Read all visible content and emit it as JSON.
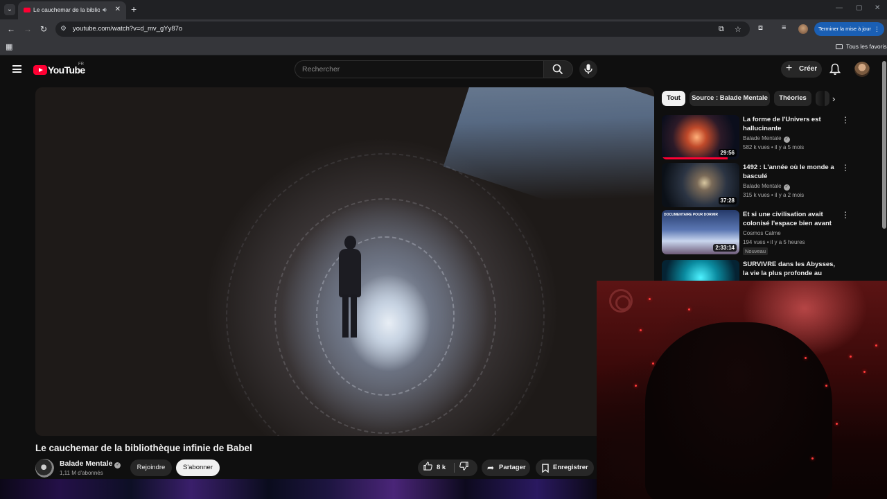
{
  "browser": {
    "tab": {
      "title": "Le cauchemar de la biblioth",
      "audio_icon": "speaker-icon",
      "close_icon": "close-icon"
    },
    "new_tab_icon": "plus-icon",
    "window_controls": [
      "minimize-icon",
      "restore-icon",
      "close-icon"
    ],
    "url": "youtube.com/watch?v=d_mv_gYy87o",
    "update_button": "Terminer la mise à jour",
    "bookmarks_folder": "Tous les favoris"
  },
  "header": {
    "logo_text": "YouTube",
    "country_code": "FR",
    "search_placeholder": "Rechercher",
    "create_label": "Créer"
  },
  "video": {
    "title": "Le cauchemar de la bibliothèque infinie de Babel",
    "channel": "Balade Mentale",
    "subscribers": "1,11 M d'abonnés",
    "join_label": "Rejoindre",
    "subscribe_label": "S'abonner",
    "likes": "8 k",
    "share_label": "Partager",
    "save_label": "Enregistrer"
  },
  "chips": [
    "Tout",
    "Source : Balade Mentale",
    "Théories"
  ],
  "recommendations": [
    {
      "title": "La forme de l'Univers est hallucinante",
      "channel": "Balade Mentale",
      "verified": true,
      "meta": "582 k vues • il y a 5 mois",
      "duration": "29:56",
      "watched_fraction": 0.85
    },
    {
      "title": "1492 : L'année où le monde a basculé",
      "channel": "Balade Mentale",
      "verified": true,
      "meta": "315 k vues • il y a 2 mois",
      "duration": "37:28"
    },
    {
      "title": "Et si une civilisation avait colonisé l'espace bien avant ...",
      "channel": "Cosmos Calme",
      "verified": false,
      "meta": "194 vues • il y a 5 heures",
      "duration": "2:33:14",
      "badge": "Nouveau",
      "thumb_label": "DOCUMENTAIRE POUR DORMIR"
    },
    {
      "title": "SURVIVRE dans les Abysses, la vie la plus profonde au monde"
    }
  ]
}
